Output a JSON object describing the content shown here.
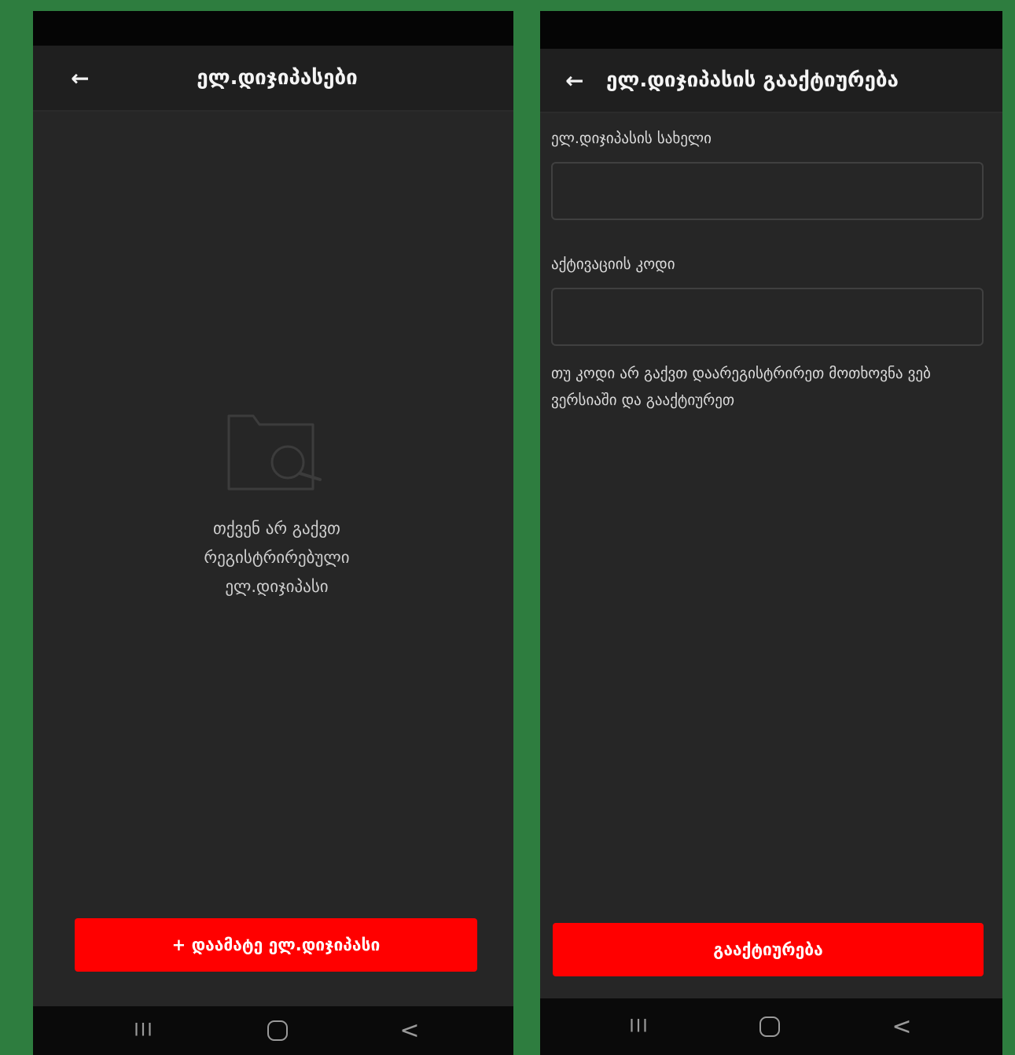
{
  "screens": {
    "wallets_list": {
      "title": "ელ.დიჯიპასები",
      "empty_message": "თქვენ არ გაქვთ რეგისტრირებული ელ.დიჯიპასი",
      "add_button_label": "+ დაამატე ელ.დიჯიპასი",
      "icons": {
        "back": "arrow-left-icon",
        "empty": "folder-search-icon"
      }
    },
    "activation": {
      "title": "ელ.დიჯიპასის გააქტიურება",
      "name_label": "ელ.დიჯიპასის სახელი",
      "name_value": "",
      "code_label": "აქტივაციის კოდი",
      "code_value": "",
      "hint": "თუ კოდი არ გაქვთ დაარეგისტრირეთ მოთხოვნა ვებ ვერსიაში და გააქტიურეთ",
      "activate_button_label": "გააქტიურება",
      "icons": {
        "back": "arrow-left-icon"
      }
    }
  },
  "navigation_bar": {
    "recents_glyph": "III",
    "back_glyph": "<"
  },
  "colors": {
    "background_frame": "#2e7d3f",
    "screen_background": "#262626",
    "app_bar": "#1f1f1f",
    "accent_button": "#ff0000",
    "status_bar": "#050505",
    "nav_bar": "#0a0a0a"
  }
}
